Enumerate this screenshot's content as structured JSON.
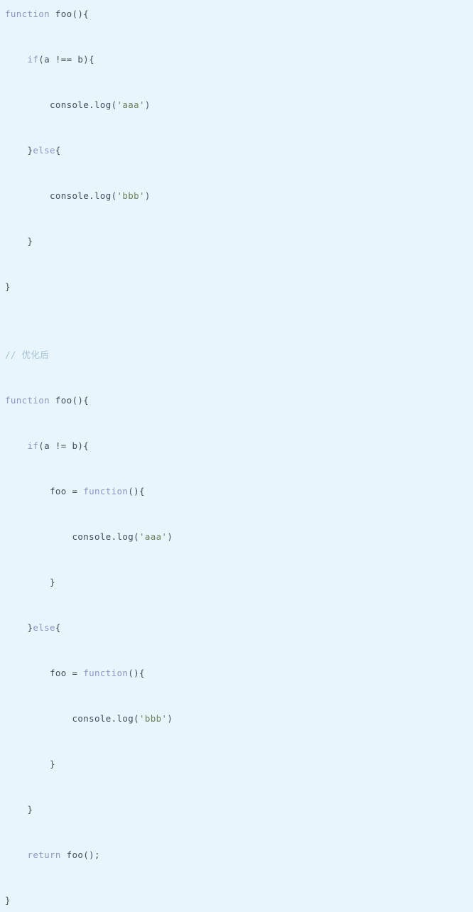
{
  "editor": {
    "background_color": "#e9f5fd",
    "language": "javascript",
    "colors": {
      "keyword": "#8b95c9",
      "plain": "#3f4f5e",
      "string": "#6b8259",
      "comment": "#a3c1d4"
    }
  },
  "lines": [
    {
      "indent": 0,
      "tokens": [
        {
          "t": "function ",
          "k": "keyword"
        },
        {
          "t": "foo(){",
          "k": "plain"
        }
      ]
    },
    {
      "indent": 0,
      "tokens": []
    },
    {
      "indent": 1,
      "tokens": [
        {
          "t": "if",
          "k": "keyword"
        },
        {
          "t": "(a !== b){",
          "k": "plain"
        }
      ]
    },
    {
      "indent": 0,
      "tokens": []
    },
    {
      "indent": 2,
      "tokens": [
        {
          "t": "console.log(",
          "k": "plain"
        },
        {
          "t": "'aaa'",
          "k": "string"
        },
        {
          "t": ")",
          "k": "plain"
        }
      ]
    },
    {
      "indent": 0,
      "tokens": []
    },
    {
      "indent": 1,
      "tokens": [
        {
          "t": "}",
          "k": "plain"
        },
        {
          "t": "else",
          "k": "keyword"
        },
        {
          "t": "{",
          "k": "plain"
        }
      ]
    },
    {
      "indent": 0,
      "tokens": []
    },
    {
      "indent": 2,
      "tokens": [
        {
          "t": "console.log(",
          "k": "plain"
        },
        {
          "t": "'bbb'",
          "k": "string"
        },
        {
          "t": ")",
          "k": "plain"
        }
      ]
    },
    {
      "indent": 0,
      "tokens": []
    },
    {
      "indent": 1,
      "tokens": [
        {
          "t": "}",
          "k": "plain"
        }
      ]
    },
    {
      "indent": 0,
      "tokens": []
    },
    {
      "indent": 0,
      "tokens": [
        {
          "t": "}",
          "k": "plain"
        }
      ]
    },
    {
      "indent": 0,
      "tokens": []
    },
    {
      "indent": 0,
      "tokens": []
    },
    {
      "indent": 0,
      "tokens": [
        {
          "t": "// ",
          "k": "comment"
        },
        {
          "t": "优化后",
          "k": "comment-cn"
        }
      ]
    },
    {
      "indent": 0,
      "tokens": []
    },
    {
      "indent": 0,
      "tokens": [
        {
          "t": "function ",
          "k": "keyword"
        },
        {
          "t": "foo(){",
          "k": "plain"
        }
      ]
    },
    {
      "indent": 0,
      "tokens": []
    },
    {
      "indent": 1,
      "tokens": [
        {
          "t": "if",
          "k": "keyword"
        },
        {
          "t": "(a != b){",
          "k": "plain"
        }
      ]
    },
    {
      "indent": 0,
      "tokens": []
    },
    {
      "indent": 2,
      "tokens": [
        {
          "t": "foo = ",
          "k": "plain"
        },
        {
          "t": "function",
          "k": "keyword"
        },
        {
          "t": "(){",
          "k": "plain"
        }
      ]
    },
    {
      "indent": 0,
      "tokens": []
    },
    {
      "indent": 3,
      "tokens": [
        {
          "t": "console.log(",
          "k": "plain"
        },
        {
          "t": "'aaa'",
          "k": "string"
        },
        {
          "t": ")",
          "k": "plain"
        }
      ]
    },
    {
      "indent": 0,
      "tokens": []
    },
    {
      "indent": 2,
      "tokens": [
        {
          "t": "}",
          "k": "plain"
        }
      ]
    },
    {
      "indent": 0,
      "tokens": []
    },
    {
      "indent": 1,
      "tokens": [
        {
          "t": "}",
          "k": "plain"
        },
        {
          "t": "else",
          "k": "keyword"
        },
        {
          "t": "{",
          "k": "plain"
        }
      ]
    },
    {
      "indent": 0,
      "tokens": []
    },
    {
      "indent": 2,
      "tokens": [
        {
          "t": "foo = ",
          "k": "plain"
        },
        {
          "t": "function",
          "k": "keyword"
        },
        {
          "t": "(){",
          "k": "plain"
        }
      ]
    },
    {
      "indent": 0,
      "tokens": []
    },
    {
      "indent": 3,
      "tokens": [
        {
          "t": "console.log(",
          "k": "plain"
        },
        {
          "t": "'bbb'",
          "k": "string"
        },
        {
          "t": ")",
          "k": "plain"
        }
      ]
    },
    {
      "indent": 0,
      "tokens": []
    },
    {
      "indent": 2,
      "tokens": [
        {
          "t": "}",
          "k": "plain"
        }
      ]
    },
    {
      "indent": 0,
      "tokens": []
    },
    {
      "indent": 1,
      "tokens": [
        {
          "t": "}",
          "k": "plain"
        }
      ]
    },
    {
      "indent": 0,
      "tokens": []
    },
    {
      "indent": 1,
      "tokens": [
        {
          "t": "return ",
          "k": "keyword"
        },
        {
          "t": "foo();",
          "k": "plain"
        }
      ]
    },
    {
      "indent": 0,
      "tokens": []
    },
    {
      "indent": 0,
      "tokens": [
        {
          "t": "}",
          "k": "plain"
        }
      ]
    }
  ]
}
